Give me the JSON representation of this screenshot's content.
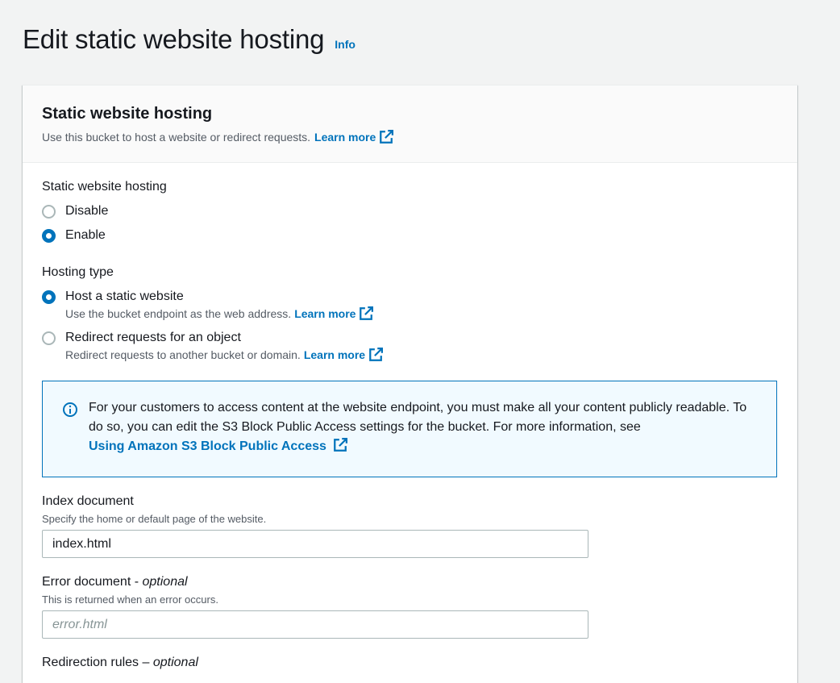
{
  "header": {
    "title": "Edit static website hosting",
    "info_label": "Info"
  },
  "panel": {
    "title": "Static website hosting",
    "description": "Use this bucket to host a website or redirect requests.",
    "learn_more": "Learn more"
  },
  "hosting": {
    "label": "Static website hosting",
    "options": [
      {
        "label": "Disable",
        "checked": false
      },
      {
        "label": "Enable",
        "checked": true
      }
    ]
  },
  "hosting_type": {
    "label": "Hosting type",
    "options": [
      {
        "label": "Host a static website",
        "description": "Use the bucket endpoint as the web address.",
        "learn_more": "Learn more",
        "checked": true
      },
      {
        "label": "Redirect requests for an object",
        "description": "Redirect requests to another bucket or domain.",
        "learn_more": "Learn more",
        "checked": false
      }
    ]
  },
  "alert": {
    "text": "For your customers to access content at the website endpoint, you must make all your content publicly readable. To do so, you can edit the S3 Block Public Access settings for the bucket. For more information, see",
    "link": "Using Amazon S3 Block Public Access"
  },
  "index_document": {
    "label": "Index document",
    "hint": "Specify the home or default page of the website.",
    "value": "index.html"
  },
  "error_document": {
    "label": "Error document -",
    "optional": "optional",
    "hint": "This is returned when an error occurs.",
    "placeholder": "error.html"
  },
  "redirection_rules": {
    "label": "Redirection rules –",
    "optional": "optional"
  },
  "colors": {
    "link": "#0073bb",
    "background": "#f2f3f3",
    "alert_bg": "#f1faff"
  }
}
